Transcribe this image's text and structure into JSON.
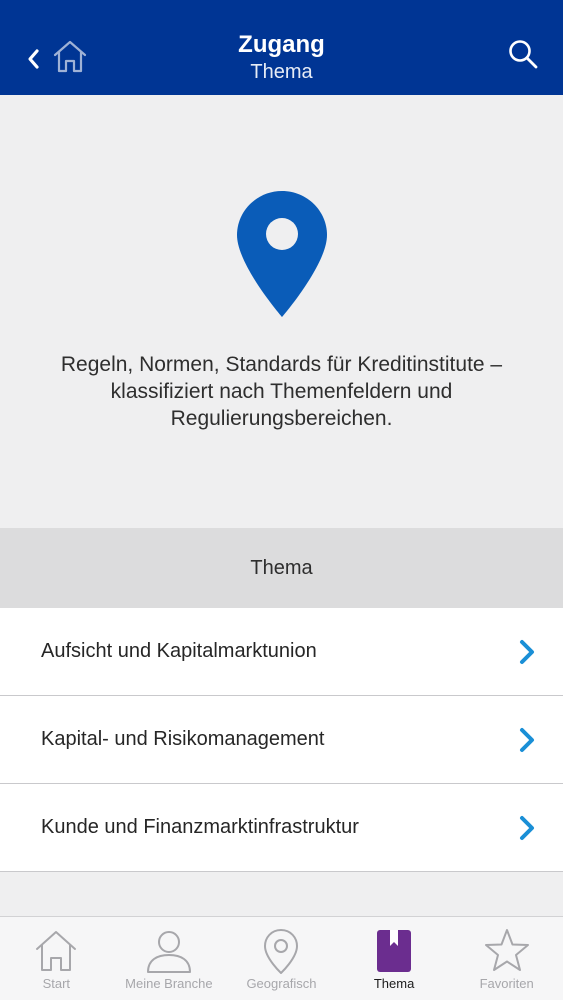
{
  "colors": {
    "nav_bg": "#003594",
    "accent_pin": "#0a5cb8",
    "chevron": "#1a8fd6",
    "active_tab": "#6b2d8f",
    "inactive_tab": "#a7a7ab"
  },
  "nav": {
    "title": "Zugang",
    "subtitle": "Thema",
    "icons": [
      "chevron-left-icon",
      "home-icon",
      "search-icon"
    ]
  },
  "hero": {
    "icon": "location-pin-icon",
    "description": "Regeln, Normen, Standards für Kreditinstitute – klassifiziert nach Themenfeldern und Regulierungsbereichen."
  },
  "section": {
    "title": "Thema"
  },
  "items": [
    {
      "label": "Aufsicht und Kapitalmarktunion"
    },
    {
      "label": "Kapital- und Risikomanagement"
    },
    {
      "label": "Kunde und Finanzmarktinfrastruktur"
    }
  ],
  "tabbar": {
    "tabs": [
      {
        "label": "Start",
        "icon": "home-icon",
        "active": false
      },
      {
        "label": "Meine Branche",
        "icon": "person-icon",
        "active": false
      },
      {
        "label": "Geografisch",
        "icon": "location-pin-icon",
        "active": false
      },
      {
        "label": "Thema",
        "icon": "bookmark-icon",
        "active": true
      },
      {
        "label": "Favoriten",
        "icon": "star-icon",
        "active": false
      }
    ]
  }
}
